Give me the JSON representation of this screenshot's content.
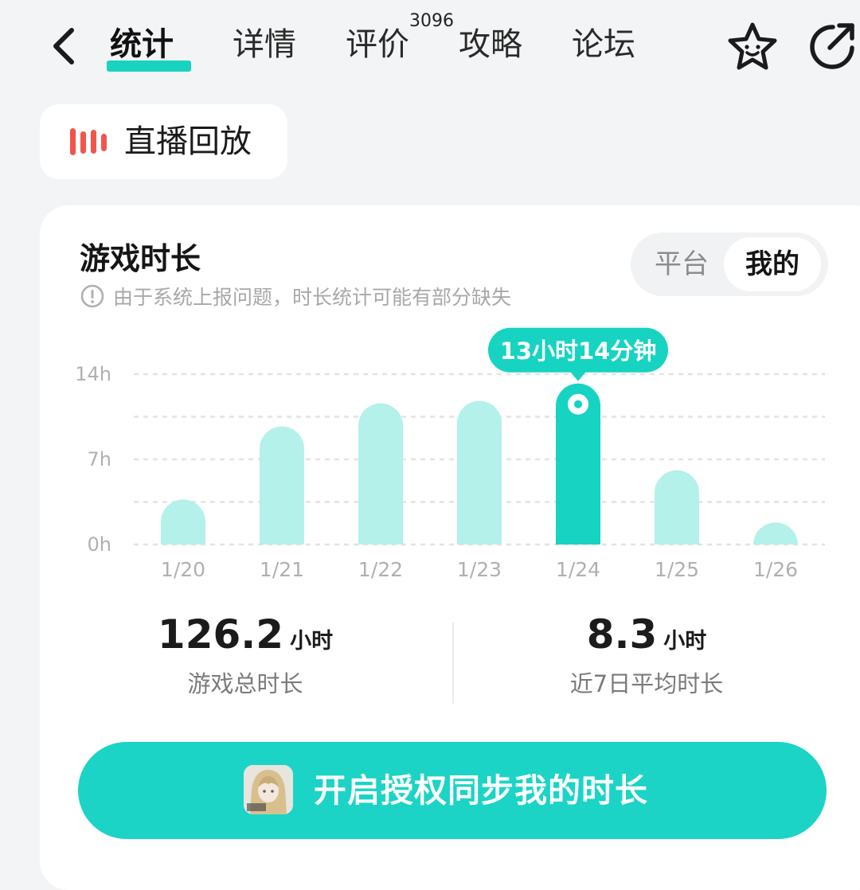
{
  "nav": {
    "tabs": [
      {
        "label": "统计",
        "active": true
      },
      {
        "label": "详情"
      },
      {
        "label": "评价",
        "badge": "3096"
      },
      {
        "label": "攻略"
      },
      {
        "label": "论坛"
      }
    ],
    "icons": {
      "back": "chevron-left-icon",
      "favorite": "star-icon",
      "share": "share-icon"
    }
  },
  "replay": {
    "label": "直播回放",
    "icon": "live-bars-icon",
    "icon_color": "#f2554b"
  },
  "card": {
    "title": "游戏时长",
    "notice": "由于系统上报问题，时长统计可能有部分缺失",
    "segment": {
      "options": [
        "平台",
        "我的"
      ],
      "selected": "我的"
    }
  },
  "chart_data": {
    "type": "bar",
    "categories": [
      "1/20",
      "1/21",
      "1/22",
      "1/23",
      "1/24",
      "1/25",
      "1/26"
    ],
    "values": [
      3.7,
      9.7,
      11.6,
      11.8,
      13.23,
      6.1,
      1.8
    ],
    "y_ticks": [
      "0h",
      "7h",
      "14h"
    ],
    "ylim": [
      0,
      14
    ],
    "highlight_index": 4,
    "tooltip": "13小时14分钟",
    "colors": {
      "bar": "#b3f1ea",
      "highlight": "#17d3c2",
      "grid": "#e3e3e3",
      "tick": "#b0b0b0"
    },
    "grid": "dashed"
  },
  "stats": {
    "total": {
      "value": "126.2",
      "unit": "小时",
      "label": "游戏总时长"
    },
    "avg": {
      "value": "8.3",
      "unit": "小时",
      "label": "近7日平均时长"
    }
  },
  "sync_button": {
    "label": "开启授权同步我的时长",
    "thumb": "game-avatar-image"
  },
  "colors": {
    "accent": "#1bd4c6",
    "background": "#f3f4f6"
  }
}
